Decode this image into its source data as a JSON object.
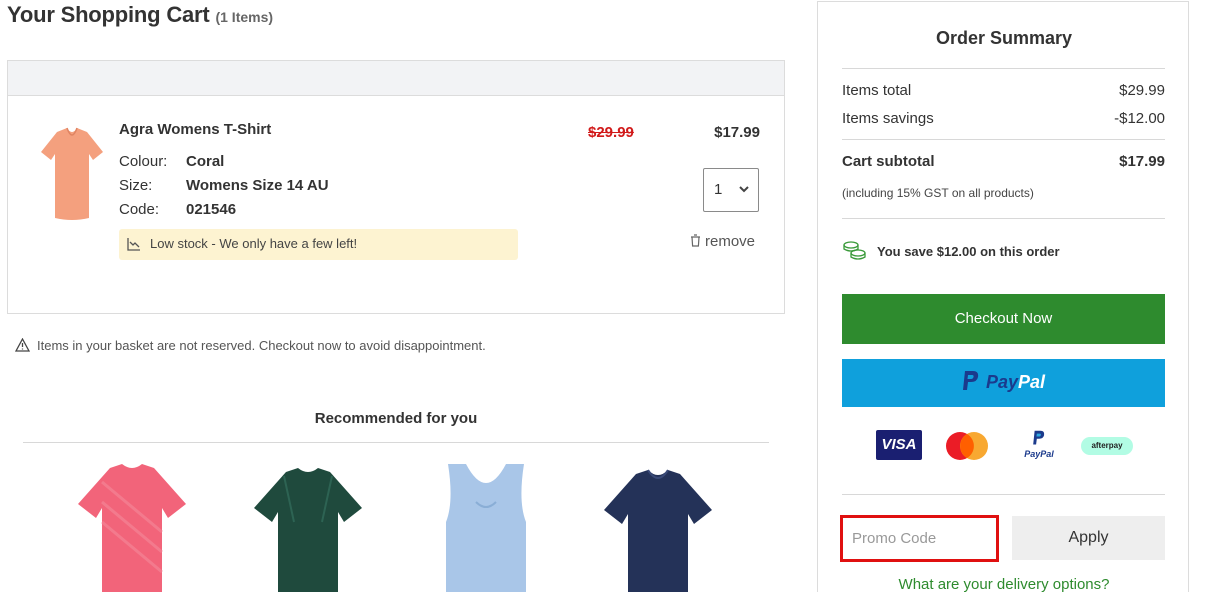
{
  "header": {
    "title": "Your Shopping Cart",
    "count": "(1 Items)"
  },
  "cart": {
    "item": {
      "name": "Agra Womens T-Shirt",
      "attributes": [
        {
          "label": "Colour:",
          "value": "Coral"
        },
        {
          "label": "Size:",
          "value": "Womens Size 14 AU"
        },
        {
          "label": "Code:",
          "value": "021546"
        }
      ],
      "stock_message": "Low stock - We only have a few left!",
      "old_price": "$29.99",
      "price": "$17.99",
      "quantity": "1",
      "remove_label": "remove",
      "image_color": "#f4a07e"
    },
    "notice": "Items in your basket are not reserved. Checkout now to avoid disappointment."
  },
  "recommended": {
    "title": "Recommended for you",
    "items": [
      {
        "icon": "tshirt-pink",
        "color": "#f2647a"
      },
      {
        "icon": "tshirt-green",
        "color": "#1f4a3d"
      },
      {
        "icon": "vest-blue",
        "color": "#a9c6e8"
      },
      {
        "icon": "tshirt-navy",
        "color": "#243258"
      }
    ]
  },
  "summary": {
    "title": "Order Summary",
    "items_total_label": "Items total",
    "items_total": "$29.99",
    "savings_label": "Items savings",
    "savings": "-$12.00",
    "subtotal_label": "Cart subtotal",
    "subtotal": "$17.99",
    "gst_note": "(including 15% GST on all products)",
    "you_save": "You save $12.00 on this order",
    "checkout_label": "Checkout Now",
    "paypal_p1": "Pay",
    "paypal_p2": "Pal",
    "visa_label": "VISA",
    "paypal_small": "PayPal",
    "afterpay_label": "afterpay",
    "promo_placeholder": "Promo Code",
    "apply_label": "Apply",
    "delivery_link": "What are your delivery options?"
  },
  "colors": {
    "accent_green": "#2e8b2e",
    "paypal_blue": "#0fa0dc",
    "sale_red": "#d11a1a",
    "promo_border": "#e01010"
  }
}
